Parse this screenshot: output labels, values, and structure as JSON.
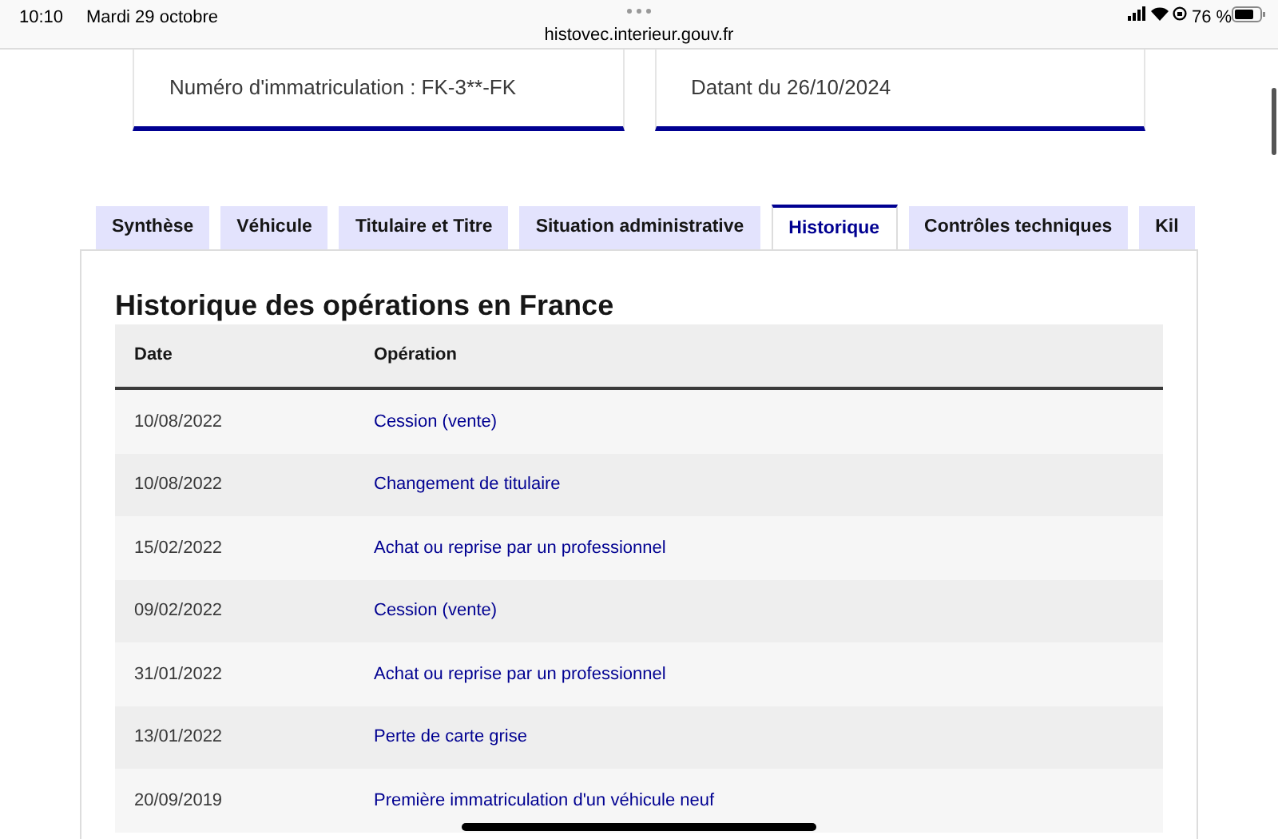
{
  "status_bar": {
    "time": "10:10",
    "date": "Mardi 29 octobre",
    "battery": "76 %"
  },
  "address_bar": {
    "url": "histovec.interieur.gouv.fr"
  },
  "cards": [
    {
      "text": "Numéro d'immatriculation : FK-3**-FK"
    },
    {
      "text": "Datant du 26/10/2024"
    }
  ],
  "tabs": [
    {
      "label": "Synthèse",
      "selected": false
    },
    {
      "label": "Véhicule",
      "selected": false
    },
    {
      "label": "Titulaire et Titre",
      "selected": false
    },
    {
      "label": "Situation administrative",
      "selected": false
    },
    {
      "label": "Historique",
      "selected": true
    },
    {
      "label": "Contrôles techniques",
      "selected": false
    },
    {
      "label": "Kil",
      "selected": false
    }
  ],
  "section_title": "Historique des opérations en France",
  "table": {
    "columns": [
      "Date",
      "Opération"
    ],
    "rows": [
      [
        "10/08/2022",
        "Cession (vente)"
      ],
      [
        "10/08/2022",
        "Changement de titulaire"
      ],
      [
        "15/02/2022",
        "Achat ou reprise par un professionnel"
      ],
      [
        "09/02/2022",
        "Cession (vente)"
      ],
      [
        "31/01/2022",
        "Achat ou reprise par un professionnel"
      ],
      [
        "13/01/2022",
        "Perte de carte grise"
      ],
      [
        "20/09/2019",
        "Première immatriculation d'un véhicule neuf"
      ]
    ]
  }
}
